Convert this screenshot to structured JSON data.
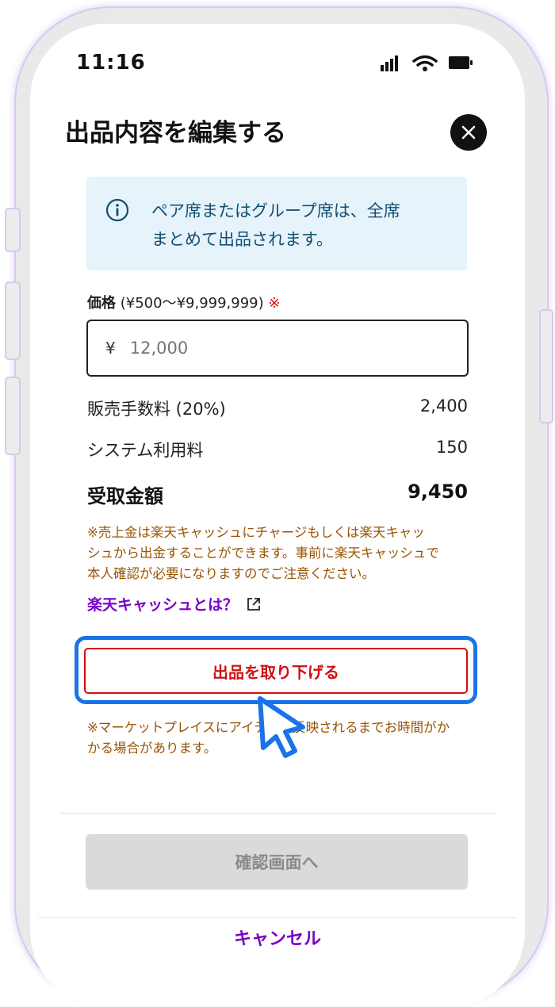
{
  "status_bar": {
    "time": "11:16"
  },
  "header": {
    "title": "出品内容を編集する"
  },
  "info": {
    "message_line1": "ペア席またはグループ席は、全席",
    "message_line2": "まとめて出品されます。"
  },
  "price": {
    "label": "価格",
    "range": "(¥500〜¥9,999,999)",
    "required_mark": "※",
    "currency": "¥",
    "placeholder": "12,000"
  },
  "fees": [
    {
      "label": "販売手数料 (20%)",
      "value": "2,400"
    },
    {
      "label": "システム利用料",
      "value": "150"
    }
  ],
  "total": {
    "label": "受取金額",
    "value": "9,450"
  },
  "notice1": [
    "※売上金は楽天キャッシュにチャージもしくは楽天キャッ",
    "シュから出金することができます。事前に楽天キャッシュで",
    "本人確認が必要になりますのでご注意ください。"
  ],
  "cash_link": "楽天キャッシュとは？",
  "withdraw_button": "出品を取り下げる",
  "notice2": [
    "※マーケットプレイスにアイテムが反映されるまでお時間がか",
    "かる場合があります。"
  ],
  "confirm_button": "確認画面へ",
  "cancel_button": "キャンセル",
  "colors": {
    "accent_purple": "#7a00c8",
    "danger_red": "#d01010",
    "focus_blue": "#1a73e8",
    "notice_brown": "#9a5300"
  }
}
